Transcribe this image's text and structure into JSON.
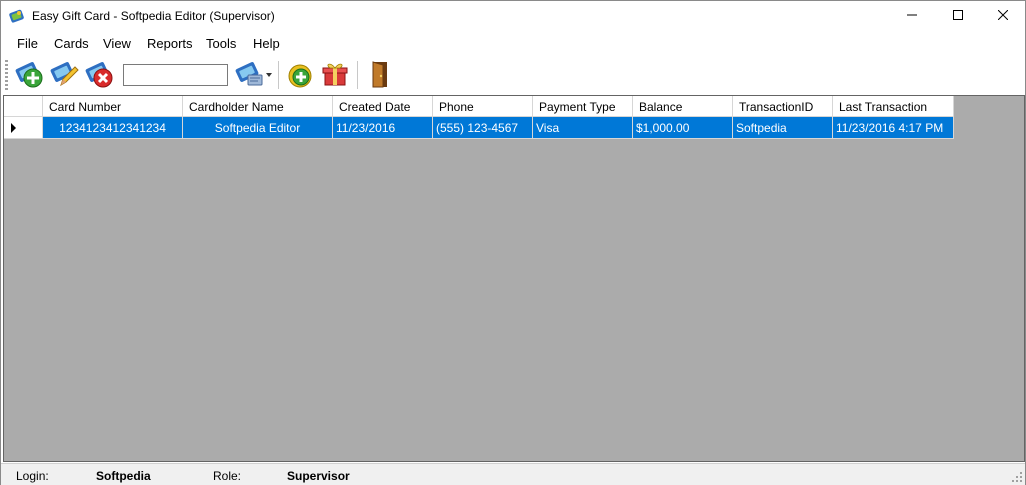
{
  "window": {
    "title": "Easy Gift Card - Softpedia Editor (Supervisor)"
  },
  "title_controls": [
    {
      "name": "minimize-icon"
    },
    {
      "name": "maximize-icon"
    },
    {
      "name": "close-icon"
    }
  ],
  "menu": [
    "File",
    "Cards",
    "View",
    "Reports",
    "Tools",
    "Help"
  ],
  "toolbar": {
    "search_value": "",
    "icons": [
      "add-card-icon",
      "edit-card-icon",
      "delete-card-icon",
      "card-options-icon",
      "add-funds-icon",
      "gift-box-icon",
      "exit-door-icon"
    ]
  },
  "grid": {
    "columns": [
      "Card Number",
      "Cardholder Name",
      "Created Date",
      "Phone",
      "Payment Type",
      "Balance",
      "TransactionID",
      "Last Transaction"
    ],
    "rows": [
      [
        "1234123412341234",
        "Softpedia Editor",
        "11/23/2016",
        "(555) 123-4567",
        "Visa",
        "$1,000.00",
        "Softpedia",
        "11/23/2016 4:17 PM"
      ]
    ]
  },
  "status": {
    "login_label": "Login:",
    "login_value": "Softpedia",
    "role_label": "Role:",
    "role_value": "Supervisor"
  },
  "colors": {
    "selection": "#0078d7",
    "grid_background": "#ababab"
  }
}
